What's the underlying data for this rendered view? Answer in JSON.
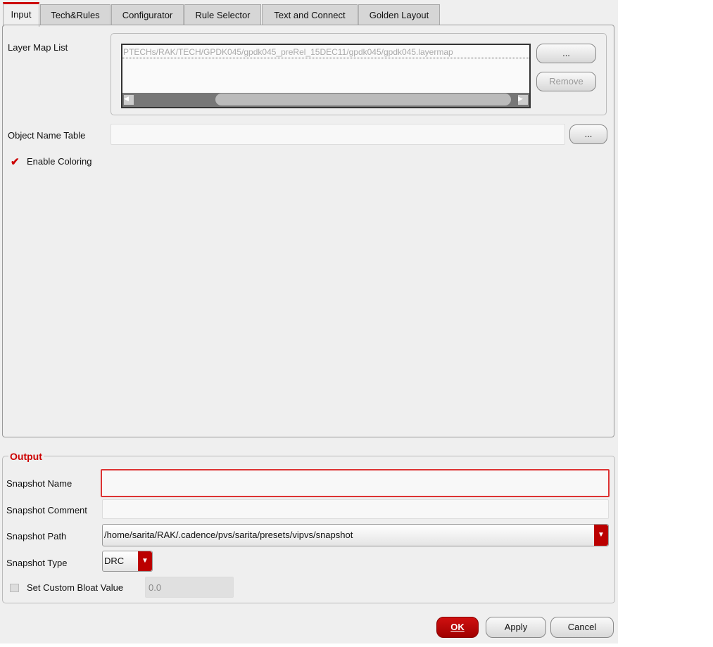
{
  "tabs": [
    "Input",
    "Tech&Rules",
    "Configurator",
    "Rule Selector",
    "Text and Connect",
    "Golden Layout"
  ],
  "input": {
    "layer_map_label": "Layer Map List",
    "layer_map_value": "PTECHs/RAK/TECH/GPDK045/gpdk045_preRel_15DEC11/gpdk045/gpdk045.layermap",
    "browse_label": "...",
    "remove_label": "Remove",
    "object_name_label": "Object Name Table",
    "object_name_value": "",
    "enable_coloring_label": "Enable Coloring",
    "enable_coloring_checked": true
  },
  "output": {
    "title": "Output",
    "snapshot_name_label": "Snapshot Name",
    "snapshot_name_value": "",
    "snapshot_comment_label": "Snapshot Comment",
    "snapshot_comment_value": "",
    "snapshot_path_label": "Snapshot Path",
    "snapshot_path_value": "/home/sarita/RAK/.cadence/pvs/sarita/presets/vipvs/snapshot",
    "snapshot_type_label": "Snapshot Type",
    "snapshot_type_value": "DRC",
    "bloat_label": "Set Custom Bloat Value",
    "bloat_checked": false,
    "bloat_value": "0.0"
  },
  "buttons": {
    "ok": "OK",
    "apply": "Apply",
    "cancel": "Cancel"
  },
  "colors": {
    "accent": "#c00000"
  }
}
